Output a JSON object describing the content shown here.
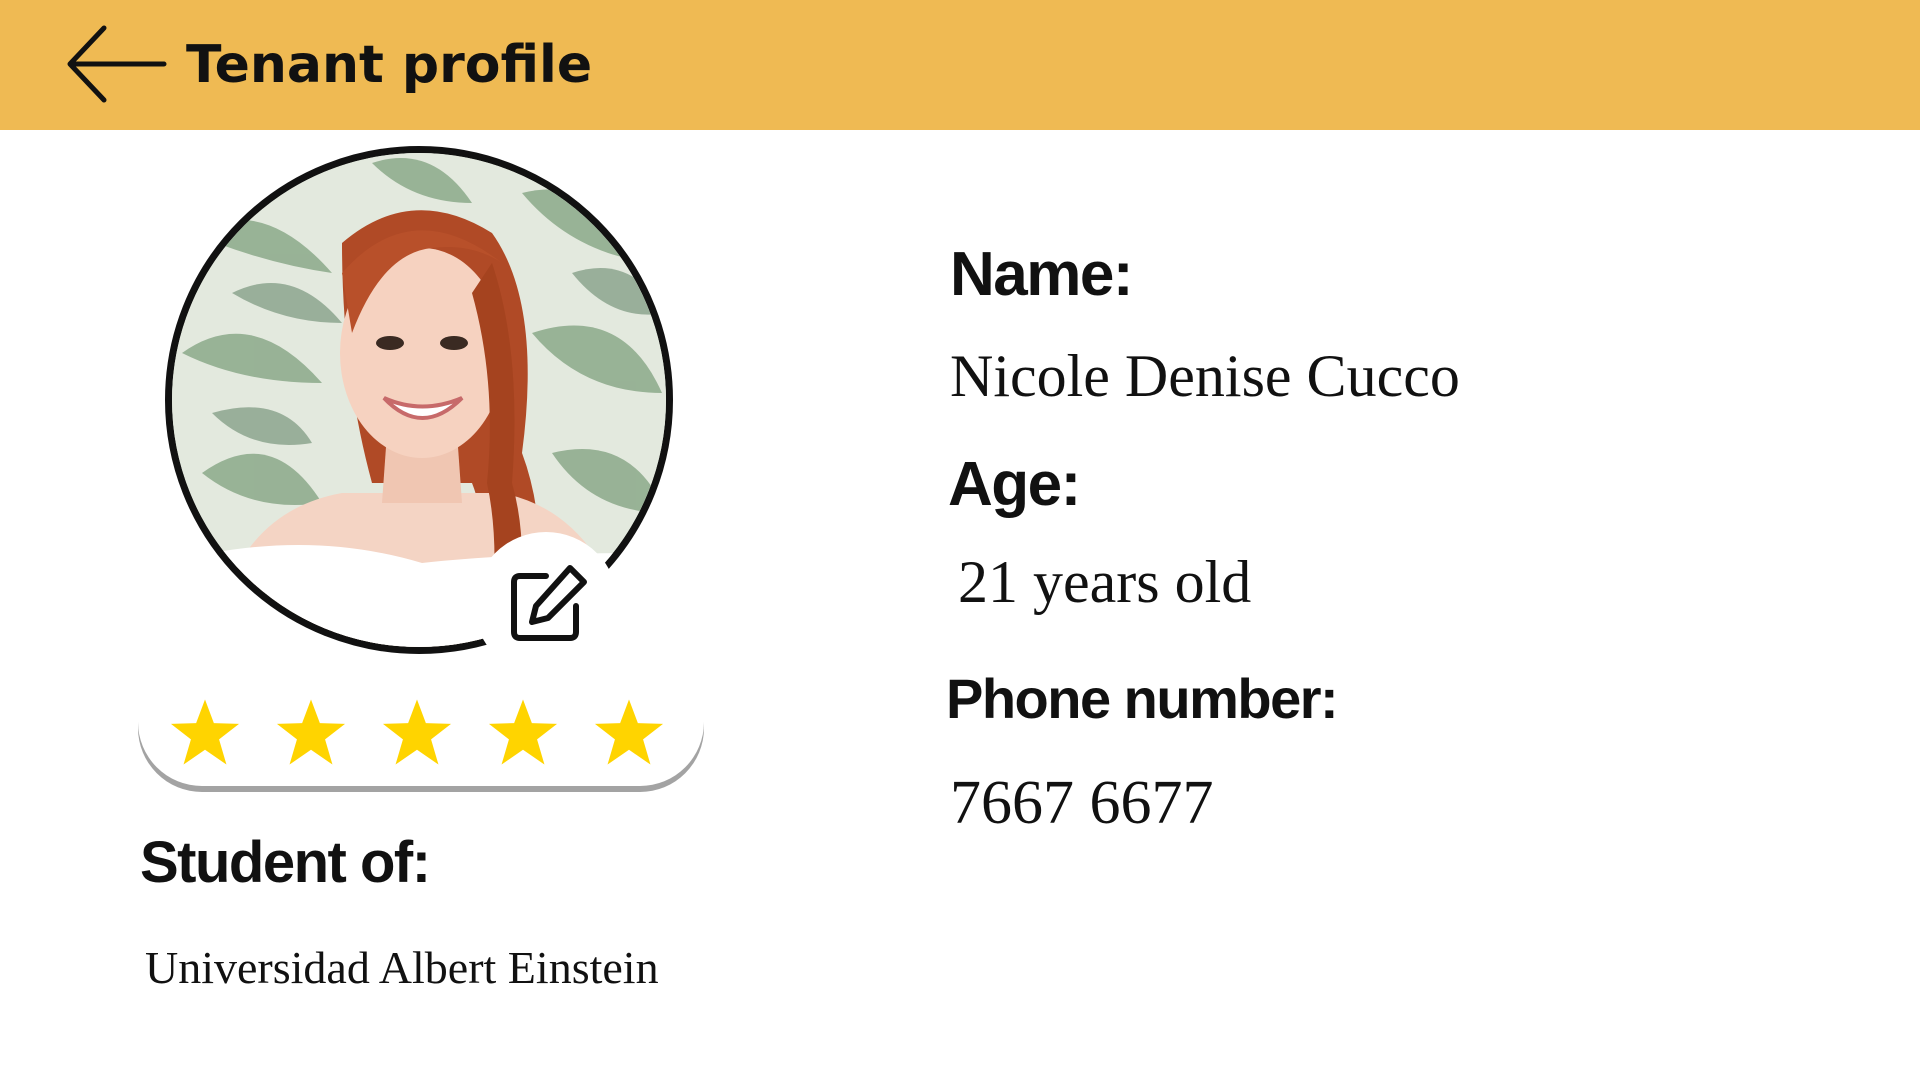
{
  "header": {
    "back_icon": "arrow-left-icon",
    "title": "Tenant profile",
    "background_color": "#efba53"
  },
  "profile": {
    "avatar_alt": "profile photo",
    "edit_icon": "edit-icon",
    "rating": 5,
    "rating_max": 5,
    "star_color": "#ffd400"
  },
  "fields": {
    "student_label": "Student of:",
    "student_value": "Universidad Albert Einstein",
    "name_label": "Name:",
    "name_value": "Nicole Denise Cucco",
    "age_label": "Age:",
    "age_value": "21 years old",
    "phone_label": "Phone number:",
    "phone_value": "7667 6677"
  }
}
